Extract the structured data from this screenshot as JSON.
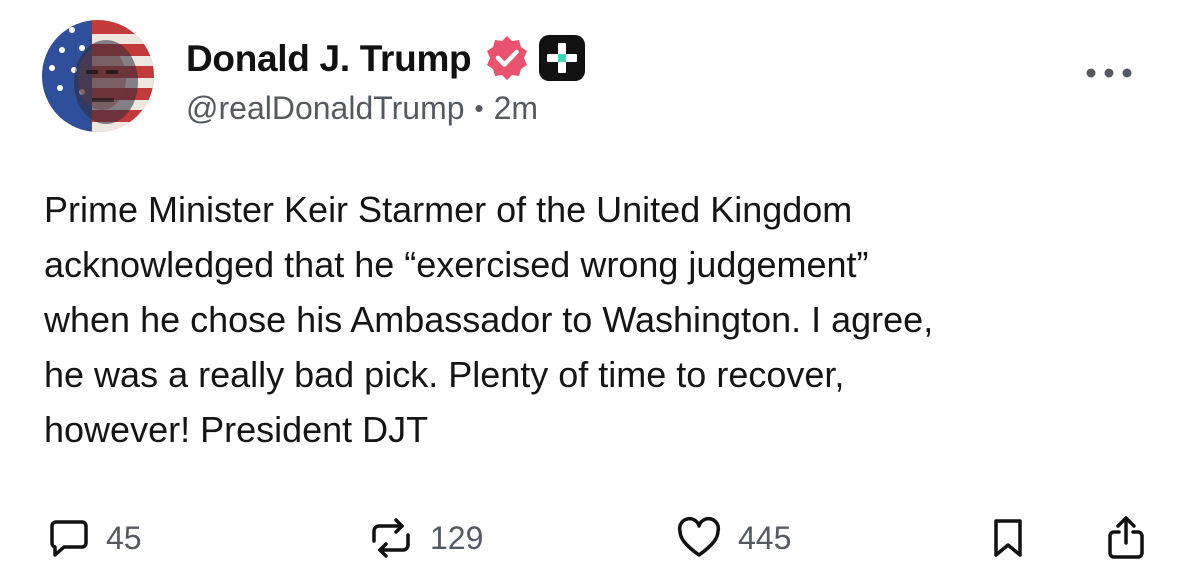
{
  "post": {
    "author": {
      "display_name": "Donald J. Trump",
      "handle": "@realDonaldTrump",
      "verified_icon": "verified-badge-icon",
      "plus_icon": "plus-badge-icon",
      "avatar_icon": "profile-avatar"
    },
    "separator": "•",
    "timestamp": "2m",
    "more_icon": "more-options-icon",
    "text": "Prime Minister Keir Starmer of the United Kingdom\nacknowledged that he “exercised wrong judgement”\nwhen he chose his Ambassador to Washington. I agree,\nhe was a really bad pick. Plenty of time to recover,\nhowever! President DJT",
    "actions": {
      "replies": {
        "icon": "reply-icon",
        "count": "45"
      },
      "reposts": {
        "icon": "repost-icon",
        "count": "129"
      },
      "likes": {
        "icon": "like-icon",
        "count": "445"
      },
      "bookmark": {
        "icon": "bookmark-icon"
      },
      "share": {
        "icon": "share-icon"
      }
    }
  },
  "colors": {
    "text_primary": "#111111",
    "text_secondary": "#555a60",
    "verified": "#e8536d",
    "plus_badge_bg": "#111111",
    "plus_badge_accent": "#3fd7b2",
    "background": "#ffffff"
  }
}
